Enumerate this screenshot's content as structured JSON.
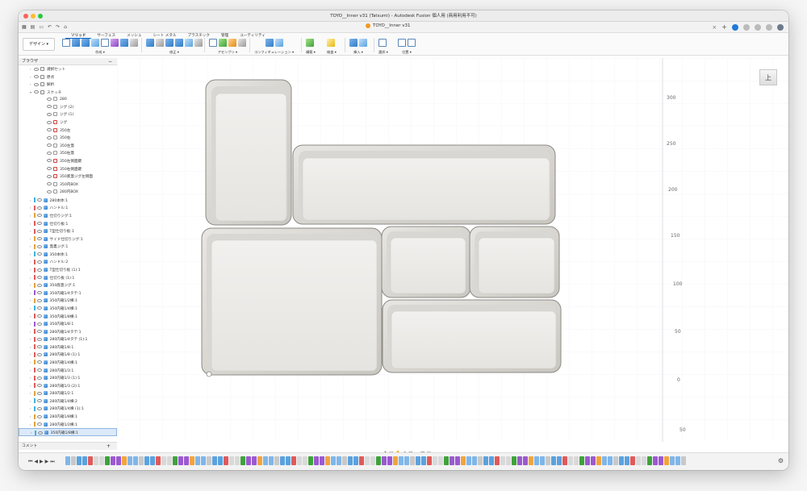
{
  "window": {
    "title": "TOYO__Inner v31 (Tatsumi) - Autodesk Fusion 個人用 (商用利用不可)"
  },
  "doc_tab": {
    "label": "TOYO__Inner v31"
  },
  "ribbon": {
    "workspace": "デザイン ▾",
    "tabs": [
      "ソリッド",
      "サーフェス",
      "メッシュ",
      "シート メタル",
      "プラスチック",
      "管理",
      "ユーティリティ"
    ],
    "groups": [
      "作成 ▾",
      "修正 ▾",
      "アセンブリ ▾",
      "コンフィギュレーション ▾",
      "構築 ▾",
      "検査 ▾",
      "挿入 ▾",
      "選択 ▾",
      "位置 ▾"
    ]
  },
  "browser": {
    "title": "ブラウザ",
    "items": [
      {
        "label": "選択セット",
        "depth": 1,
        "kind": "folder"
      },
      {
        "label": "原点",
        "depth": 1,
        "kind": "folder"
      },
      {
        "label": "解析",
        "depth": 1,
        "kind": "folder"
      },
      {
        "label": "スケッチ",
        "depth": 1,
        "kind": "folder"
      },
      {
        "label": "280",
        "depth": 2,
        "kind": "sketch"
      },
      {
        "label": "ジグ (2)",
        "depth": 2,
        "kind": "sketch"
      },
      {
        "label": "ジグ (1)",
        "depth": 2,
        "kind": "sketch"
      },
      {
        "label": "ジグ",
        "depth": 2,
        "kind": "sketch-red"
      },
      {
        "label": "350左",
        "depth": 2,
        "kind": "sketch-red"
      },
      {
        "label": "350右",
        "depth": 2,
        "kind": "sketch"
      },
      {
        "label": "350左蓋",
        "depth": 2,
        "kind": "sketch"
      },
      {
        "label": "350右蓋",
        "depth": 2,
        "kind": "sketch"
      },
      {
        "label": "350左側面鍵",
        "depth": 2,
        "kind": "sketch-red"
      },
      {
        "label": "350右側面鍵",
        "depth": 2,
        "kind": "sketch-red"
      },
      {
        "label": "350底蓋ジグ左側面",
        "depth": 2,
        "kind": "sketch-red"
      },
      {
        "label": "350内BOX",
        "depth": 2,
        "kind": "sketch"
      },
      {
        "label": "280内BOX",
        "depth": 2,
        "kind": "sketch"
      },
      {
        "label": "280本体:1",
        "depth": 1,
        "kind": "comp",
        "bar": "#3fb0e0"
      },
      {
        "label": "ハンドル:1",
        "depth": 1,
        "kind": "comp",
        "bar": "#e05a5a"
      },
      {
        "label": "仕切りジグ:1",
        "depth": 1,
        "kind": "comp",
        "bar": "#e0a23f"
      },
      {
        "label": "仕切り板:1",
        "depth": 1,
        "kind": "comp",
        "bar": "#e05a5a"
      },
      {
        "label": "T型仕切り板:1",
        "depth": 1,
        "kind": "comp",
        "bar": "#e05a5a"
      },
      {
        "label": "サイド仕切りジグ:1",
        "depth": 1,
        "kind": "comp",
        "bar": "#e0a23f"
      },
      {
        "label": "蓋裏ジグ:1",
        "depth": 1,
        "kind": "comp",
        "bar": "#e0a23f"
      },
      {
        "label": "350本体:1",
        "depth": 1,
        "kind": "comp",
        "bar": "#3fb0e0"
      },
      {
        "label": "ハンドル:2",
        "depth": 1,
        "kind": "comp",
        "bar": "#e05a5a"
      },
      {
        "label": "T型仕切り板 (1):1",
        "depth": 1,
        "kind": "comp",
        "bar": "#e05a5a"
      },
      {
        "label": "仕切り板 (1):1",
        "depth": 1,
        "kind": "comp",
        "bar": "#e05a5a"
      },
      {
        "label": "350底蓋ジグ:1",
        "depth": 1,
        "kind": "comp",
        "bar": "#e0a23f"
      },
      {
        "label": "350内箱1/4タテ:1",
        "depth": 1,
        "kind": "comp",
        "bar": "#9b59d0"
      },
      {
        "label": "350内箱1/2横:1",
        "depth": 1,
        "kind": "comp",
        "bar": "#e0a23f"
      },
      {
        "label": "350内箱1/4横:1",
        "depth": 1,
        "kind": "comp",
        "bar": "#3fb0e0"
      },
      {
        "label": "350内箱1/8横:1",
        "depth": 1,
        "kind": "comp",
        "bar": "#e05a5a"
      },
      {
        "label": "350内箱1/8:1",
        "depth": 1,
        "kind": "comp",
        "bar": "#9b59d0"
      },
      {
        "label": "280内箱1/4タテ:1",
        "depth": 1,
        "kind": "comp",
        "bar": "#e05a5a"
      },
      {
        "label": "280内箱1/4タテ (1):1",
        "depth": 1,
        "kind": "comp",
        "bar": "#e05a5a"
      },
      {
        "label": "280内箱1/8:1",
        "depth": 1,
        "kind": "comp",
        "bar": "#e05a5a"
      },
      {
        "label": "280内箱1/8 (1):1",
        "depth": 1,
        "kind": "comp",
        "bar": "#e05a5a"
      },
      {
        "label": "280内箱1/4横:1",
        "depth": 1,
        "kind": "comp",
        "bar": "#e0a23f"
      },
      {
        "label": "280内箱1/3:1",
        "depth": 1,
        "kind": "comp",
        "bar": "#e05a5a"
      },
      {
        "label": "280内箱1/3 (1):1",
        "depth": 1,
        "kind": "comp",
        "bar": "#e05a5a"
      },
      {
        "label": "280内箱1/3 (2):1",
        "depth": 1,
        "kind": "comp",
        "bar": "#e05a5a"
      },
      {
        "label": "280内箱1/2:1",
        "depth": 1,
        "kind": "comp",
        "bar": "#e0a23f"
      },
      {
        "label": "280内箱1/4横:2",
        "depth": 1,
        "kind": "comp",
        "bar": "#3fb0e0"
      },
      {
        "label": "280内箱1/4横 (1):1",
        "depth": 1,
        "kind": "comp",
        "bar": "#3fb0e0"
      },
      {
        "label": "280内箱1/8横:1",
        "depth": 1,
        "kind": "comp",
        "bar": "#e0a23f"
      },
      {
        "label": "280内箱1/2横:1",
        "depth": 1,
        "kind": "comp",
        "bar": "#e0a23f"
      },
      {
        "label": "350内箱1/8横:1",
        "depth": 1,
        "kind": "comp",
        "bar": "#3fb0e0",
        "selected": true
      }
    ]
  },
  "comment": {
    "title": "コメント"
  },
  "viewcube": {
    "face": "上"
  },
  "axis": {
    "ticks": [
      "300",
      "250",
      "200",
      "150",
      "100",
      "50",
      "0",
      "50"
    ]
  },
  "timeline": {
    "count": 110
  }
}
